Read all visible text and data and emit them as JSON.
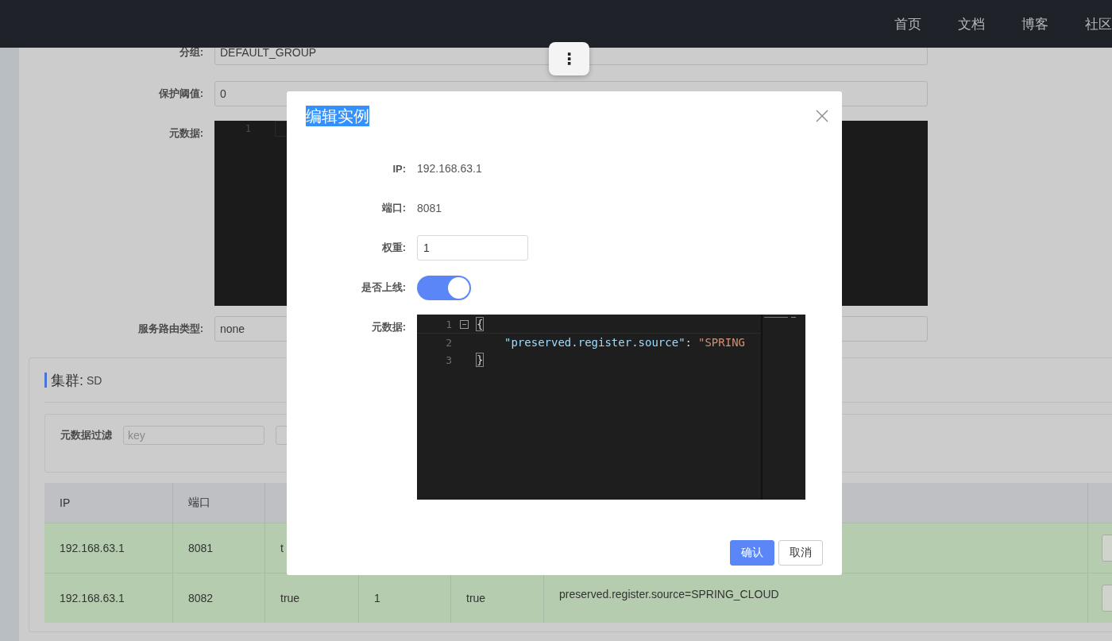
{
  "nav": {
    "items": [
      "首页",
      "文档",
      "博客",
      "社区"
    ]
  },
  "more_button": "⋮",
  "form": {
    "fields": [
      {
        "kind": "input",
        "label": "分组:",
        "value": "DEFAULT_GROUP"
      },
      {
        "kind": "input",
        "label": "保护阈值:",
        "value": "0"
      },
      {
        "kind": "editor",
        "label": "元数据:",
        "lines": [
          {
            "number": "1"
          }
        ]
      },
      {
        "kind": "input",
        "label": "服务路由类型:",
        "value": "none"
      }
    ]
  },
  "cluster": {
    "title": "集群:",
    "name": "SD",
    "filter": {
      "label": "元数据过滤",
      "placeholder": "key"
    },
    "table": {
      "columns": [
        {
          "label": "IP"
        },
        {
          "label": "端口"
        },
        {},
        {},
        {},
        {},
        {}
      ],
      "rows": [
        {
          "cells": [
            "192.168.63.1",
            "8081",
            "t",
            null,
            null,
            null,
            null
          ]
        },
        {
          "cells": [
            "192.168.63.1",
            "8082",
            "true",
            "1",
            "true",
            "preserved.register.source=SPRING_CLOUD",
            null
          ]
        }
      ]
    }
  },
  "modal": {
    "title": "编辑实例",
    "title_highlighted": true,
    "fields": [
      {
        "kind": "text",
        "label": "IP:",
        "value": "192.168.63.1"
      },
      {
        "kind": "text",
        "label": "端口:",
        "value": "8081"
      },
      {
        "kind": "input",
        "label": "权重:",
        "value": "1"
      },
      {
        "kind": "switch",
        "label": "是否上线:",
        "on": true
      },
      {
        "kind": "editor",
        "label": "元数据:",
        "lines": [
          {
            "number": "1",
            "foldable": true,
            "indented": false,
            "tokens": [
              {
                "kind": "brace",
                "text": "{"
              }
            ]
          },
          {
            "number": "2",
            "foldable": false,
            "indented": true,
            "tokens": [
              {
                "kind": "key",
                "text": "\"preserved.register.source\""
              },
              {
                "kind": "punct",
                "text": ":"
              },
              {
                "kind": "string",
                "text": "\"SPRING"
              }
            ]
          },
          {
            "number": "3",
            "foldable": false,
            "indented": false,
            "tokens": [
              {
                "kind": "brace",
                "text": "}"
              }
            ]
          }
        ]
      }
    ],
    "buttons": [
      {
        "label": "确认",
        "kind": "primary"
      },
      {
        "label": "取消",
        "kind": "default"
      }
    ]
  }
}
